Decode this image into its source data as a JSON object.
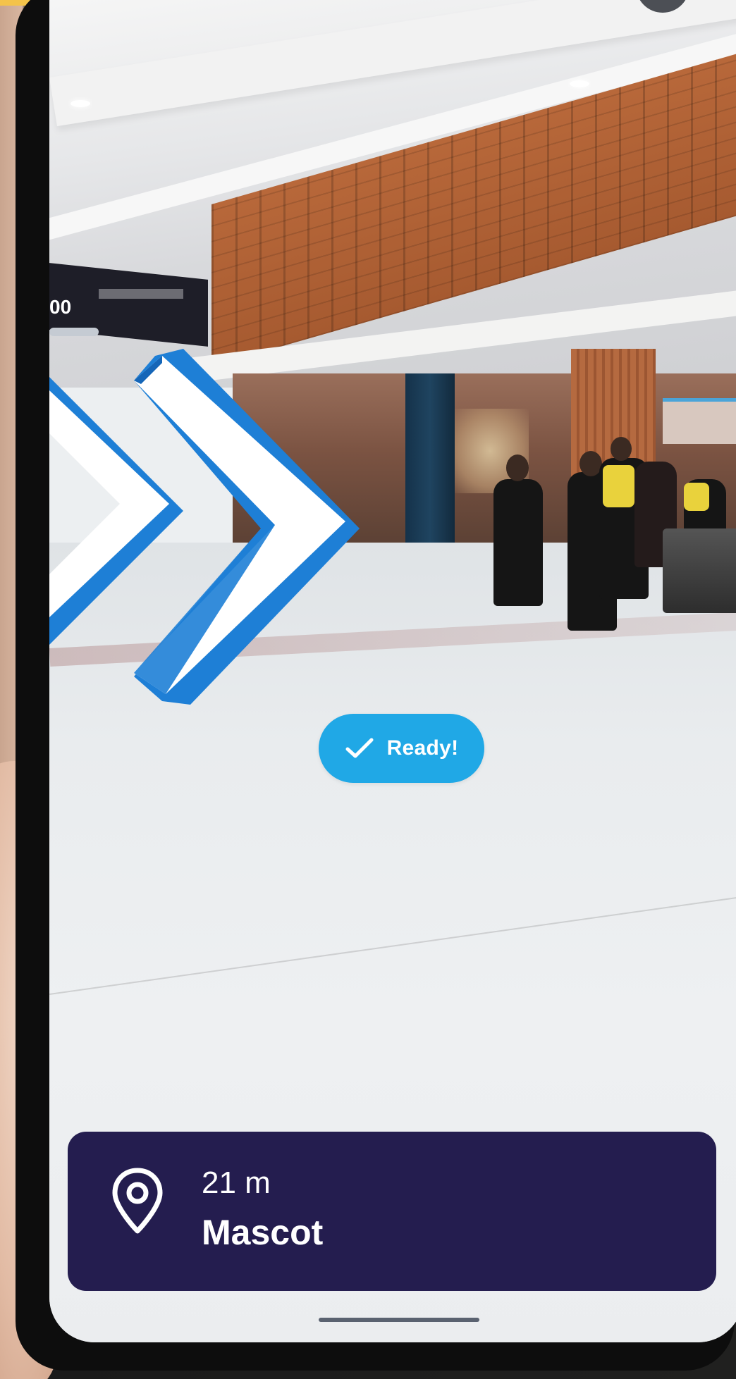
{
  "ar_navigation": {
    "status_pill": {
      "label": "Ready!",
      "icon": "checkmark-icon",
      "color": "#20a8e6"
    },
    "destination": {
      "distance": "21 m",
      "name": "Mascot",
      "icon": "location-pin-icon"
    },
    "direction_arrows": {
      "icon": "chevron-right-icon",
      "count": 2,
      "color": "#1e7fd6"
    },
    "colors": {
      "card_background": "#241d4f",
      "accent": "#f4c34a"
    }
  }
}
